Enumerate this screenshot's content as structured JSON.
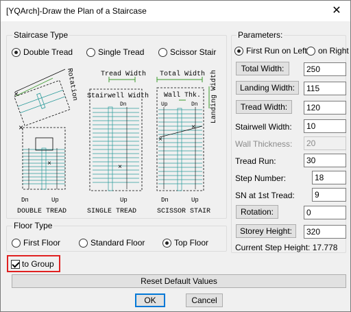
{
  "window": {
    "title": "[YQArch]-Draw the Plan of a Staircase"
  },
  "staircase_type": {
    "legend": "Staircase Type",
    "options": [
      {
        "label": "Double Tread",
        "selected": true
      },
      {
        "label": "Single Tread",
        "selected": false
      },
      {
        "label": "Scissor Stair",
        "selected": false
      }
    ]
  },
  "diagram": {
    "rotation": "Rotation",
    "tread_width": "Tread Width",
    "total_width": "Total Width",
    "stairwell_width": "Stairwell Width",
    "wall_thk": "Wall Thk.",
    "landing_width": "Landing Width",
    "dn": "Dn",
    "up": "Up",
    "double_caption": "DOUBLE TREAD",
    "single_caption": "SINGLE TREAD",
    "scissor_caption": "SCISSOR STAIR",
    "accent_green": "#3a9a2a",
    "accent_cyan": "#2a9a9a"
  },
  "floor_type": {
    "legend": "Floor Type",
    "options": [
      {
        "label": "First Floor",
        "selected": false
      },
      {
        "label": "Standard Floor",
        "selected": false
      },
      {
        "label": "Top Floor",
        "selected": true
      }
    ]
  },
  "to_group": {
    "label": "to Group",
    "checked": true
  },
  "parameters": {
    "legend": "Parameters:",
    "run_options": [
      {
        "label": "First Run on Left",
        "selected": true
      },
      {
        "label": "on Right",
        "selected": false
      }
    ],
    "total_width": {
      "label": "Total Width:",
      "value": "250"
    },
    "landing_width": {
      "label": "Landing Width:",
      "value": "115"
    },
    "tread_width": {
      "label": "Tread Width:",
      "value": "120"
    },
    "stairwell_width": {
      "label": "Stairwell Width:",
      "value": "10"
    },
    "wall_thickness": {
      "label": "Wall Thickness:",
      "value": "20"
    },
    "tread_run": {
      "label": "Tread Run:",
      "value": "30"
    },
    "step_number": {
      "label": "Step Number:",
      "value": "18"
    },
    "sn_first_tread": {
      "label": "SN at 1st Tread:",
      "value": "9"
    },
    "rotation": {
      "label": "Rotation:",
      "value": "0"
    },
    "storey_height": {
      "label": "Storey Height:",
      "value": "320"
    },
    "current_step_height": "Current Step Height: 17.778"
  },
  "buttons": {
    "reset": "Reset Default Values",
    "ok": "OK",
    "cancel": "Cancel"
  },
  "colors": {
    "highlight": "#e02020",
    "default_button_border": "#0078d7"
  }
}
